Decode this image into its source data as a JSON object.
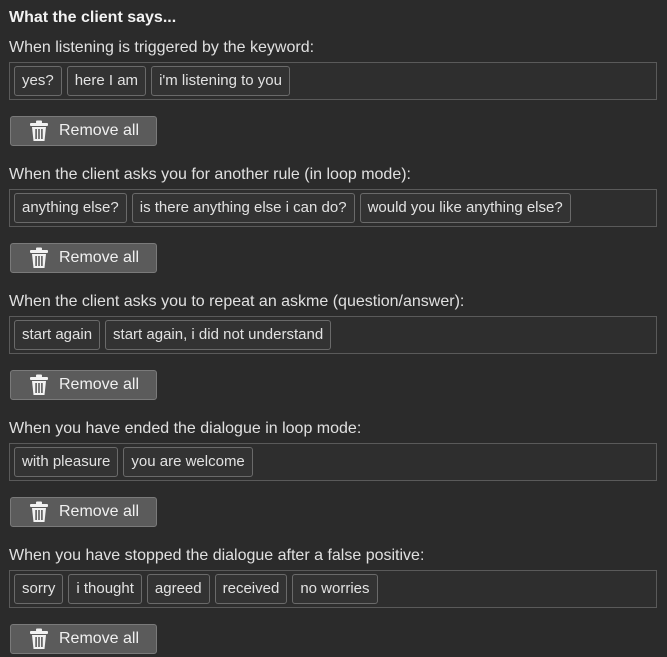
{
  "title": "What the client says...",
  "remove_all_label": "Remove all",
  "icons": {
    "remove": "trash-icon"
  },
  "sections": [
    {
      "label": "When listening is triggered by the keyword:",
      "tags": [
        "yes?",
        "here I am",
        "i'm listening to you"
      ]
    },
    {
      "label": "When the client asks you for another rule (in loop mode):",
      "tags": [
        "anything else?",
        "is there anything else i can do?",
        "would you like anything else?"
      ]
    },
    {
      "label": "When the client asks you to repeat an askme (question/answer):",
      "tags": [
        "start again",
        "start again, i did not understand"
      ]
    },
    {
      "label": "When you have ended the dialogue in loop mode:",
      "tags": [
        "with pleasure",
        "you are welcome"
      ]
    },
    {
      "label": "When you have stopped the dialogue after a false positive:",
      "tags": [
        "sorry",
        "i thought",
        "agreed",
        "received",
        "no worries"
      ]
    }
  ]
}
